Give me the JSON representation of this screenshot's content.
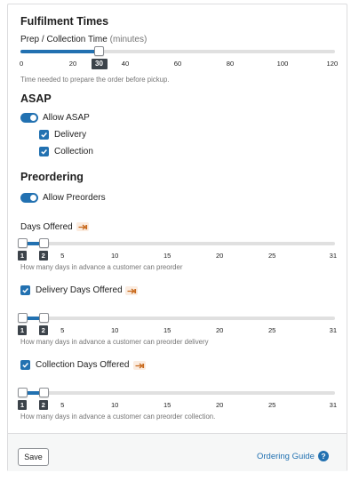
{
  "fulfilment": {
    "title": "Fulfilment Times",
    "prep_label": "Prep / Collection Time",
    "prep_unit": "(minutes)",
    "prep_value": 30,
    "prep_value_label": "30",
    "prep_range": [
      0,
      120
    ],
    "prep_ticks": [
      "0",
      "20",
      "40",
      "60",
      "80",
      "100",
      "120"
    ],
    "prep_help": "Time needed to prepare the order before pickup."
  },
  "asap": {
    "title": "ASAP",
    "allow_label": "Allow ASAP",
    "allow_enabled": true,
    "delivery_label": "Delivery",
    "delivery_checked": true,
    "collection_label": "Collection",
    "collection_checked": true
  },
  "preordering": {
    "title": "Preordering",
    "allow_label": "Allow Preorders",
    "allow_enabled": true,
    "range": [
      1,
      31
    ],
    "ticks": [
      "5",
      "10",
      "15",
      "20",
      "25",
      "31"
    ],
    "days_offered": {
      "label": "Days Offered",
      "value": [
        1,
        2
      ],
      "badge_min": "1",
      "badge_max": "2",
      "help": "How many days in advance a customer can preorder"
    },
    "delivery_days": {
      "label": "Delivery Days Offered",
      "checked": true,
      "value": [
        1,
        2
      ],
      "badge_min": "1",
      "badge_max": "2",
      "help": "How many days in advance a customer can preorder delivery"
    },
    "collection_days": {
      "label": "Collection Days Offered",
      "checked": true,
      "value": [
        1,
        2
      ],
      "badge_min": "1",
      "badge_max": "2",
      "help": "How many days in advance a customer can preorder collection."
    }
  },
  "footer": {
    "save_label": "Save",
    "guide_label": "Ordering Guide",
    "guide_icon": "?"
  },
  "colors": {
    "accent": "#2271b1",
    "info_icon": "#c8691c",
    "badge": "#3c434a"
  }
}
